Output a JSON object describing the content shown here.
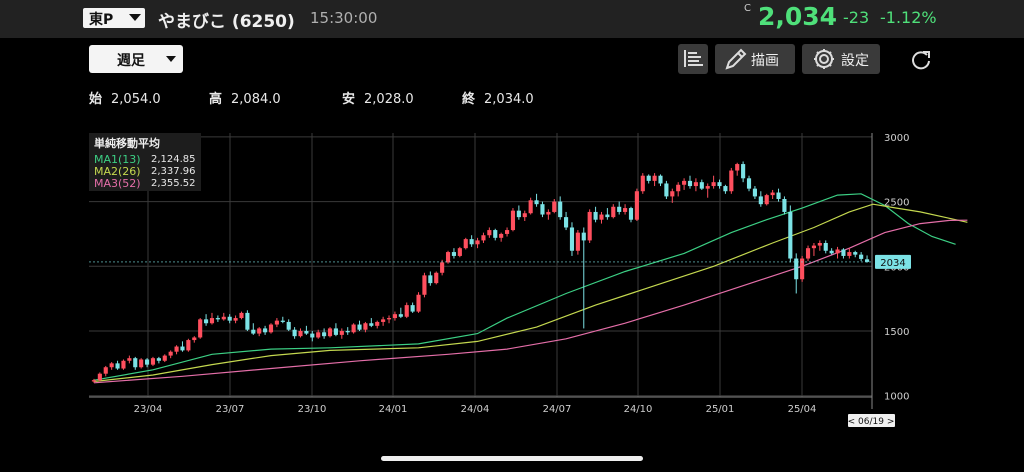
{
  "header": {
    "market": "東P",
    "name": "やまびこ (6250)",
    "time": "15:30:00",
    "price_flag": "C",
    "price": "2,034",
    "change": "-23",
    "change_pct": "-1.12%",
    "up_color": "#4fe07a"
  },
  "toolbar": {
    "period": "週足",
    "draw_label": "描画",
    "settings_label": "設定",
    "icons": [
      "bar-list-icon",
      "pencil-icon",
      "gear-icon",
      "refresh-icon"
    ]
  },
  "ohlc": {
    "open_label": "始",
    "open": "2,054.0",
    "high_label": "高",
    "high": "2,084.0",
    "low_label": "安",
    "low": "2,028.0",
    "close_label": "終",
    "close": "2,034.0"
  },
  "legend": {
    "title": "単純移動平均",
    "items": [
      {
        "name": "MA1(13)",
        "value": "2,124.85",
        "color": "#3ccf84"
      },
      {
        "name": "MA2(26)",
        "value": "2,337.96",
        "color": "#c4d84f"
      },
      {
        "name": "MA3(52)",
        "value": "2,355.52",
        "color": "#e46ea8"
      }
    ]
  },
  "chart_data": {
    "type": "candlestick",
    "interval": "weekly",
    "x_tick_labels": [
      "23/04",
      "23/07",
      "23/10",
      "24/01",
      "24/04",
      "24/07",
      "24/10",
      "25/01",
      "25/04"
    ],
    "y_ticks": [
      1000,
      1500,
      2000,
      2500,
      3000
    ],
    "ylim": [
      990,
      3030
    ],
    "last_price": 2034,
    "last_price_label": "2034",
    "cursor_date_label": "< 06/19 >",
    "up_color": "#ff4f5e",
    "down_color": "#7ce3e6",
    "candles": [
      [
        1110,
        1130,
        1100,
        1120
      ],
      [
        1120,
        1180,
        1110,
        1170
      ],
      [
        1170,
        1230,
        1150,
        1220
      ],
      [
        1220,
        1260,
        1200,
        1250
      ],
      [
        1250,
        1270,
        1200,
        1210
      ],
      [
        1210,
        1280,
        1200,
        1270
      ],
      [
        1270,
        1310,
        1250,
        1290
      ],
      [
        1290,
        1300,
        1200,
        1220
      ],
      [
        1220,
        1290,
        1210,
        1280
      ],
      [
        1280,
        1290,
        1220,
        1240
      ],
      [
        1240,
        1300,
        1230,
        1290
      ],
      [
        1290,
        1300,
        1250,
        1270
      ],
      [
        1270,
        1320,
        1260,
        1310
      ],
      [
        1310,
        1350,
        1290,
        1340
      ],
      [
        1340,
        1390,
        1320,
        1380
      ],
      [
        1380,
        1420,
        1340,
        1350
      ],
      [
        1350,
        1440,
        1340,
        1430
      ],
      [
        1430,
        1460,
        1410,
        1450
      ],
      [
        1450,
        1600,
        1440,
        1590
      ],
      [
        1590,
        1630,
        1540,
        1560
      ],
      [
        1560,
        1640,
        1550,
        1600
      ],
      [
        1600,
        1620,
        1570,
        1590
      ],
      [
        1590,
        1640,
        1580,
        1610
      ],
      [
        1610,
        1630,
        1560,
        1580
      ],
      [
        1580,
        1620,
        1560,
        1600
      ],
      [
        1600,
        1650,
        1590,
        1640
      ],
      [
        1640,
        1660,
        1500,
        1510
      ],
      [
        1510,
        1560,
        1470,
        1480
      ],
      [
        1480,
        1530,
        1460,
        1520
      ],
      [
        1520,
        1540,
        1470,
        1490
      ],
      [
        1490,
        1560,
        1480,
        1550
      ],
      [
        1550,
        1600,
        1530,
        1580
      ],
      [
        1580,
        1610,
        1560,
        1570
      ],
      [
        1570,
        1590,
        1500,
        1510
      ],
      [
        1510,
        1530,
        1440,
        1460
      ],
      [
        1460,
        1520,
        1450,
        1500
      ],
      [
        1500,
        1540,
        1470,
        1480
      ],
      [
        1480,
        1500,
        1420,
        1450
      ],
      [
        1450,
        1510,
        1440,
        1490
      ],
      [
        1490,
        1520,
        1440,
        1460
      ],
      [
        1460,
        1530,
        1450,
        1520
      ],
      [
        1520,
        1560,
        1460,
        1470
      ],
      [
        1470,
        1520,
        1440,
        1500
      ],
      [
        1500,
        1530,
        1470,
        1490
      ],
      [
        1490,
        1560,
        1480,
        1550
      ],
      [
        1550,
        1580,
        1500,
        1510
      ],
      [
        1510,
        1570,
        1490,
        1560
      ],
      [
        1560,
        1600,
        1530,
        1540
      ],
      [
        1540,
        1580,
        1520,
        1570
      ],
      [
        1570,
        1610,
        1540,
        1590
      ],
      [
        1590,
        1620,
        1560,
        1600
      ],
      [
        1600,
        1650,
        1580,
        1630
      ],
      [
        1630,
        1680,
        1600,
        1610
      ],
      [
        1610,
        1720,
        1600,
        1700
      ],
      [
        1700,
        1720,
        1640,
        1650
      ],
      [
        1650,
        1800,
        1640,
        1780
      ],
      [
        1780,
        1950,
        1760,
        1930
      ],
      [
        1930,
        1960,
        1850,
        1870
      ],
      [
        1870,
        1960,
        1860,
        1950
      ],
      [
        1950,
        2050,
        1930,
        2030
      ],
      [
        2030,
        2120,
        2020,
        2110
      ],
      [
        2110,
        2140,
        2060,
        2080
      ],
      [
        2080,
        2150,
        2070,
        2140
      ],
      [
        2140,
        2220,
        2130,
        2210
      ],
      [
        2210,
        2240,
        2150,
        2170
      ],
      [
        2170,
        2220,
        2140,
        2200
      ],
      [
        2200,
        2260,
        2180,
        2240
      ],
      [
        2240,
        2300,
        2220,
        2280
      ],
      [
        2280,
        2290,
        2200,
        2220
      ],
      [
        2220,
        2260,
        2190,
        2250
      ],
      [
        2250,
        2300,
        2230,
        2280
      ],
      [
        2280,
        2450,
        2270,
        2430
      ],
      [
        2430,
        2470,
        2360,
        2380
      ],
      [
        2380,
        2430,
        2350,
        2410
      ],
      [
        2410,
        2530,
        2400,
        2510
      ],
      [
        2510,
        2560,
        2460,
        2480
      ],
      [
        2480,
        2500,
        2380,
        2400
      ],
      [
        2400,
        2440,
        2360,
        2420
      ],
      [
        2420,
        2520,
        2410,
        2500
      ],
      [
        2500,
        2540,
        2360,
        2380
      ],
      [
        2380,
        2420,
        2280,
        2300
      ],
      [
        2300,
        2340,
        2080,
        2120
      ],
      [
        2120,
        2280,
        2090,
        2260
      ],
      [
        2260,
        2300,
        1520,
        2200
      ],
      [
        2200,
        2440,
        2180,
        2420
      ],
      [
        2420,
        2460,
        2340,
        2360
      ],
      [
        2360,
        2420,
        2330,
        2400
      ],
      [
        2400,
        2450,
        2360,
        2380
      ],
      [
        2380,
        2480,
        2370,
        2460
      ],
      [
        2460,
        2500,
        2400,
        2420
      ],
      [
        2420,
        2480,
        2400,
        2450
      ],
      [
        2450,
        2460,
        2340,
        2360
      ],
      [
        2360,
        2600,
        2350,
        2580
      ],
      [
        2580,
        2720,
        2560,
        2700
      ],
      [
        2700,
        2710,
        2640,
        2660
      ],
      [
        2660,
        2720,
        2620,
        2700
      ],
      [
        2700,
        2710,
        2620,
        2640
      ],
      [
        2640,
        2660,
        2520,
        2540
      ],
      [
        2540,
        2600,
        2490,
        2580
      ],
      [
        2580,
        2650,
        2540,
        2630
      ],
      [
        2630,
        2680,
        2590,
        2660
      ],
      [
        2660,
        2700,
        2600,
        2620
      ],
      [
        2620,
        2680,
        2580,
        2650
      ],
      [
        2650,
        2670,
        2590,
        2600
      ],
      [
        2600,
        2640,
        2530,
        2620
      ],
      [
        2620,
        2700,
        2600,
        2650
      ],
      [
        2650,
        2670,
        2600,
        2620
      ],
      [
        2620,
        2630,
        2560,
        2580
      ],
      [
        2580,
        2760,
        2560,
        2740
      ],
      [
        2740,
        2800,
        2700,
        2790
      ],
      [
        2790,
        2810,
        2650,
        2680
      ],
      [
        2680,
        2700,
        2580,
        2600
      ],
      [
        2600,
        2620,
        2520,
        2540
      ],
      [
        2540,
        2580,
        2460,
        2480
      ],
      [
        2480,
        2560,
        2470,
        2550
      ],
      [
        2550,
        2590,
        2520,
        2570
      ],
      [
        2570,
        2600,
        2500,
        2520
      ],
      [
        2520,
        2540,
        2400,
        2420
      ],
      [
        2420,
        2470,
        2030,
        2060
      ],
      [
        2060,
        2100,
        1790,
        1900
      ],
      [
        1900,
        2080,
        1880,
        2060
      ],
      [
        2060,
        2160,
        2040,
        2140
      ],
      [
        2140,
        2180,
        2080,
        2160
      ],
      [
        2160,
        2200,
        2120,
        2180
      ],
      [
        2180,
        2200,
        2100,
        2120
      ],
      [
        2120,
        2140,
        2090,
        2100
      ],
      [
        2100,
        2150,
        2060,
        2130
      ],
      [
        2130,
        2140,
        2060,
        2080
      ],
      [
        2080,
        2140,
        2060,
        2110
      ],
      [
        2110,
        2120,
        2070,
        2090
      ],
      [
        2090,
        2110,
        2040,
        2057
      ],
      [
        2054,
        2084,
        2028,
        2034
      ]
    ],
    "series": [
      {
        "name": "MA1(13)",
        "color": "#3ccf84",
        "values": [
          [
            0,
            1120
          ],
          [
            10,
            1200
          ],
          [
            20,
            1320
          ],
          [
            30,
            1360
          ],
          [
            40,
            1370
          ],
          [
            55,
            1400
          ],
          [
            65,
            1480
          ],
          [
            70,
            1600
          ],
          [
            80,
            1790
          ],
          [
            90,
            1960
          ],
          [
            100,
            2100
          ],
          [
            108,
            2260
          ],
          [
            114,
            2360
          ],
          [
            120,
            2450
          ],
          [
            126,
            2550
          ],
          [
            130,
            2560
          ],
          [
            134,
            2470
          ],
          [
            138,
            2330
          ],
          [
            142,
            2230
          ],
          [
            146,
            2170
          ]
        ]
      },
      {
        "name": "MA2(26)",
        "color": "#c4d84f",
        "values": [
          [
            0,
            1110
          ],
          [
            10,
            1160
          ],
          [
            20,
            1240
          ],
          [
            30,
            1310
          ],
          [
            40,
            1350
          ],
          [
            55,
            1370
          ],
          [
            65,
            1420
          ],
          [
            75,
            1530
          ],
          [
            85,
            1700
          ],
          [
            95,
            1850
          ],
          [
            105,
            2000
          ],
          [
            115,
            2180
          ],
          [
            122,
            2300
          ],
          [
            128,
            2420
          ],
          [
            132,
            2480
          ],
          [
            136,
            2450
          ],
          [
            140,
            2420
          ],
          [
            144,
            2380
          ],
          [
            148,
            2340
          ]
        ]
      },
      {
        "name": "MA3(52)",
        "color": "#e46ea8",
        "values": [
          [
            0,
            1100
          ],
          [
            15,
            1150
          ],
          [
            30,
            1210
          ],
          [
            45,
            1270
          ],
          [
            60,
            1320
          ],
          [
            70,
            1360
          ],
          [
            80,
            1440
          ],
          [
            90,
            1560
          ],
          [
            100,
            1700
          ],
          [
            110,
            1850
          ],
          [
            120,
            2000
          ],
          [
            128,
            2140
          ],
          [
            134,
            2260
          ],
          [
            140,
            2330
          ],
          [
            145,
            2355
          ],
          [
            148,
            2356
          ]
        ]
      }
    ]
  }
}
